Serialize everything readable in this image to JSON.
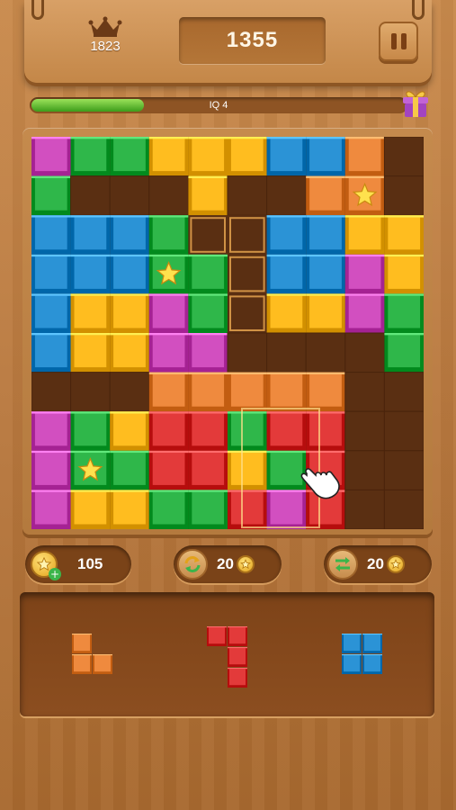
{
  "header": {
    "best_score": "1823",
    "score": "1355",
    "pause_label": "Pause"
  },
  "progress": {
    "label": "IQ 4",
    "fraction": 0.3
  },
  "boosters": {
    "coins": "105",
    "rotate_cost": "20",
    "swap_cost": "20"
  },
  "colors": {
    "pink": "#d24fc0",
    "green": "#2fb74a",
    "yellow": "#ffbd1f",
    "blue": "#2b93d6",
    "orange": "#ef8a3e",
    "red": "#e33a3a",
    "empty": "#5a2f12",
    "ghost": "#d09245"
  },
  "board": {
    "rows": [
      [
        "P",
        "G",
        "G",
        "Y",
        "Y",
        "Y",
        "B",
        "B",
        "O",
        "."
      ],
      [
        "G",
        ".",
        ".",
        ".",
        "Y",
        ".",
        ".",
        "O",
        "O*",
        "."
      ],
      [
        "B",
        "B",
        "B",
        "G",
        "H",
        "H",
        "B",
        "B",
        "Y",
        "Y"
      ],
      [
        "B",
        "B",
        "B",
        "G*",
        "G",
        "H",
        "B",
        "B",
        "P",
        "Y"
      ],
      [
        "B",
        "Y",
        "Y",
        "P",
        "G",
        "H",
        "Y",
        "Y",
        "P",
        "G"
      ],
      [
        "B",
        "Y",
        "Y",
        "P",
        "P",
        ".",
        ".",
        ".",
        ".",
        "G"
      ],
      [
        ".",
        ".",
        ".",
        "O",
        "O",
        "O",
        "O",
        "O",
        ".",
        "."
      ],
      [
        "P",
        "G",
        "Y",
        "R",
        "R",
        "G",
        "R",
        "R",
        ".",
        "."
      ],
      [
        "P",
        "G*",
        "G",
        "R",
        "R",
        "Y",
        "G",
        "R",
        ".",
        "."
      ],
      [
        "P",
        "Y",
        "Y",
        "G",
        "G",
        "R",
        "P",
        "R",
        ".",
        "."
      ]
    ]
  },
  "tray": {
    "pieces": [
      {
        "color": "orange",
        "cells": [
          [
            0,
            0
          ],
          [
            1,
            0
          ],
          [
            1,
            1
          ]
        ]
      },
      {
        "color": "red",
        "cells": [
          [
            0,
            0
          ],
          [
            0,
            1
          ],
          [
            1,
            1
          ],
          [
            2,
            1
          ]
        ]
      },
      {
        "color": "blue",
        "cells": [
          [
            0,
            0
          ],
          [
            0,
            1
          ],
          [
            1,
            0
          ],
          [
            1,
            1
          ]
        ]
      }
    ]
  }
}
